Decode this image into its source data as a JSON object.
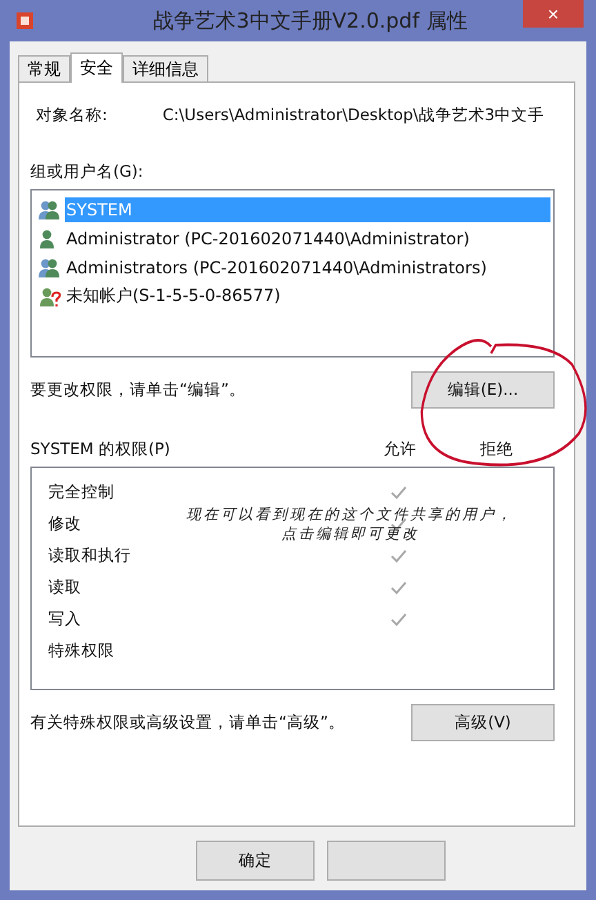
{
  "window": {
    "title": "战争艺术3中文手册V2.0.pdf 属性",
    "close": "×"
  },
  "tabs": [
    {
      "label": "常规",
      "selected": false
    },
    {
      "label": "安全",
      "selected": true
    },
    {
      "label": "详细信息",
      "selected": false
    }
  ],
  "object_name": {
    "label": "对象名称:",
    "value": "C:\\Users\\Administrator\\Desktop\\战争艺术3中文手"
  },
  "groups": {
    "label": "组或用户名(G):",
    "items": [
      {
        "kind": "group",
        "name": "SYSTEM",
        "selected": true
      },
      {
        "kind": "user",
        "name": "Administrator (PC-201602071440\\Administrator)",
        "selected": false
      },
      {
        "kind": "group",
        "name": "Administrators (PC-201602071440\\Administrators)",
        "selected": false
      },
      {
        "kind": "unknown",
        "name": "未知帐户(S-1-5-5-0-86577)",
        "selected": false
      }
    ]
  },
  "edit_hint": "要更改权限，请单击“编辑”。",
  "edit_button": "编辑(E)...",
  "permissions": {
    "label": "SYSTEM 的权限(P)",
    "allow_header": "允许",
    "deny_header": "拒绝",
    "rows": [
      {
        "name": "完全控制",
        "allow": true,
        "deny": false
      },
      {
        "name": "修改",
        "allow": true,
        "deny": false
      },
      {
        "name": "读取和执行",
        "allow": true,
        "deny": false
      },
      {
        "name": "读取",
        "allow": true,
        "deny": false
      },
      {
        "name": "写入",
        "allow": true,
        "deny": false
      },
      {
        "name": "特殊权限",
        "allow": false,
        "deny": false
      }
    ]
  },
  "annotation": {
    "lines": [
      "现在可以看到现在的这个文件共享的用户，",
      "点击编辑即可更改"
    ]
  },
  "advanced_hint": "有关特殊权限或高级设置，请单击“高级”。",
  "advanced_button": "高级(V)",
  "buttons": [
    {
      "kind": "ok",
      "label": "确定"
    },
    {
      "kind": "hidden"
    }
  ]
}
